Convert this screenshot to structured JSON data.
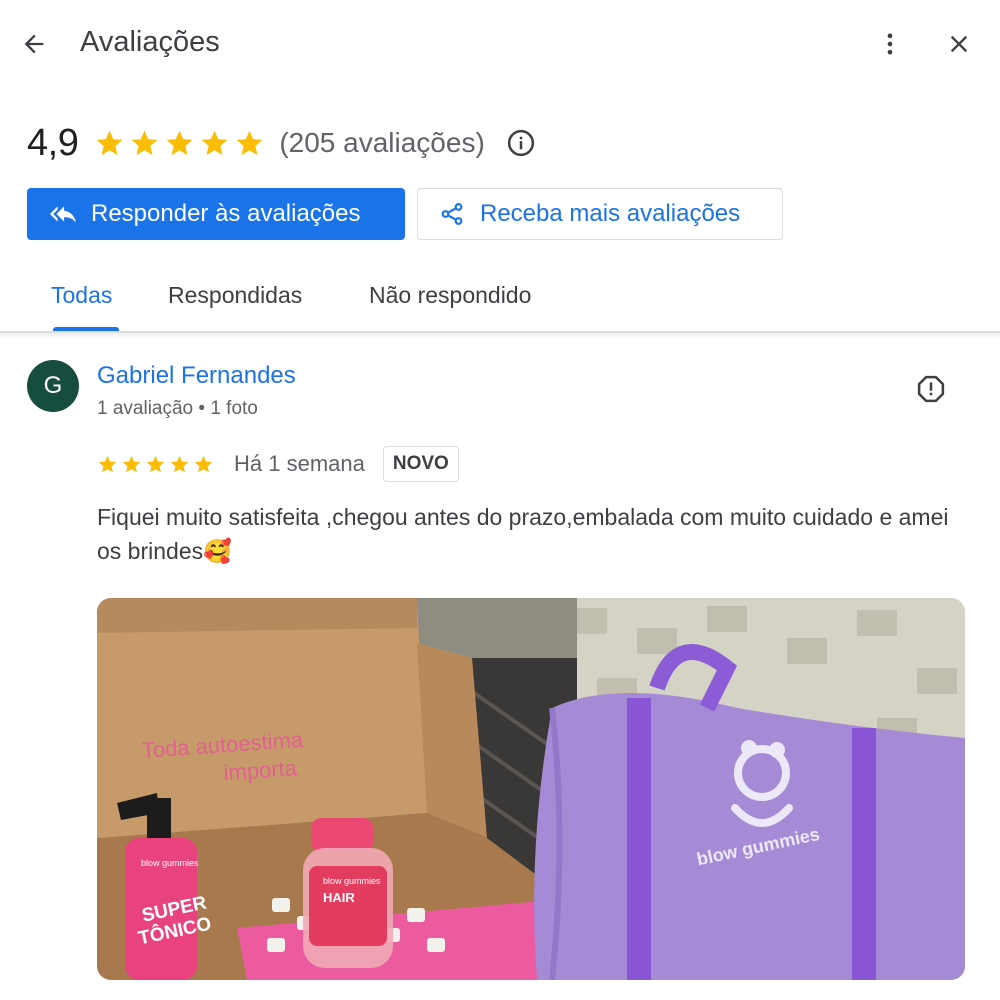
{
  "header": {
    "title": "Avaliações",
    "back_icon": "arrow-back-icon",
    "more_icon": "more-vert-icon",
    "close_icon": "close-icon"
  },
  "summary": {
    "rating": "4,9",
    "stars": 5,
    "count_label": "(205 avaliações)",
    "star_color": "#fbbc04"
  },
  "actions": {
    "reply_label": "Responder às avaliações",
    "get_more_label": "Receba mais avaliações",
    "accent_color": "#1a73e8"
  },
  "tabs": [
    {
      "label": "Todas",
      "active": true
    },
    {
      "label": "Respondidas",
      "active": false
    },
    {
      "label": "Não respondido",
      "active": false
    }
  ],
  "review": {
    "avatar_letter": "G",
    "name": "Gabriel Fernandes",
    "meta": "1 avaliação • 1 foto",
    "stars": 5,
    "date": "Há 1 semana",
    "badge": "NOVO",
    "text": "Fiquei muito satisfeita ,chegou antes do prazo,embalada com muito cuidado e amei os brindes🥰",
    "photo": {
      "box_text_line1": "Toda autoestima",
      "box_text_line2": "importa",
      "bag_brand": "blow gummies",
      "spray_brand": "blow gummies",
      "spray_line1": "SUPER",
      "spray_line2": "TÔNICO",
      "jar_brand": "blow gummies",
      "jar_label": "HAIR"
    }
  }
}
